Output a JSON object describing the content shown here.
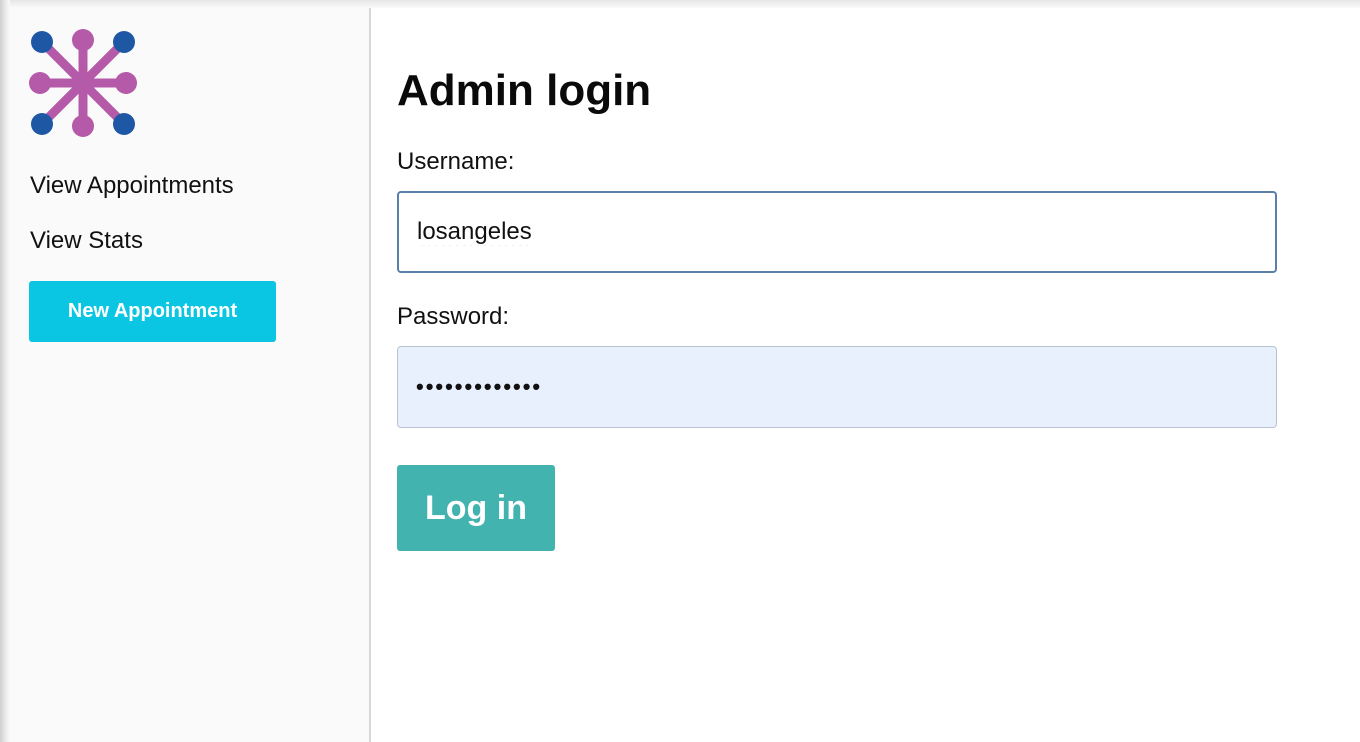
{
  "colors": {
    "accent_cyan": "#0bc6e3",
    "login_teal": "#42b3ae",
    "password_fill": "#e8f0fe",
    "logo_purple": "#b45aa9",
    "logo_blue": "#1e58a5"
  },
  "sidebar": {
    "logo_icon": "molecule-network-logo-icon",
    "items": [
      {
        "label": "View Appointments"
      },
      {
        "label": "View Stats"
      }
    ],
    "new_appointment_label": "New Appointment"
  },
  "main": {
    "title": "Admin login",
    "username_label": "Username:",
    "username_value": "losangeles",
    "password_label": "Password:",
    "password_value": "•••••••••••••",
    "login_label": "Log in"
  }
}
